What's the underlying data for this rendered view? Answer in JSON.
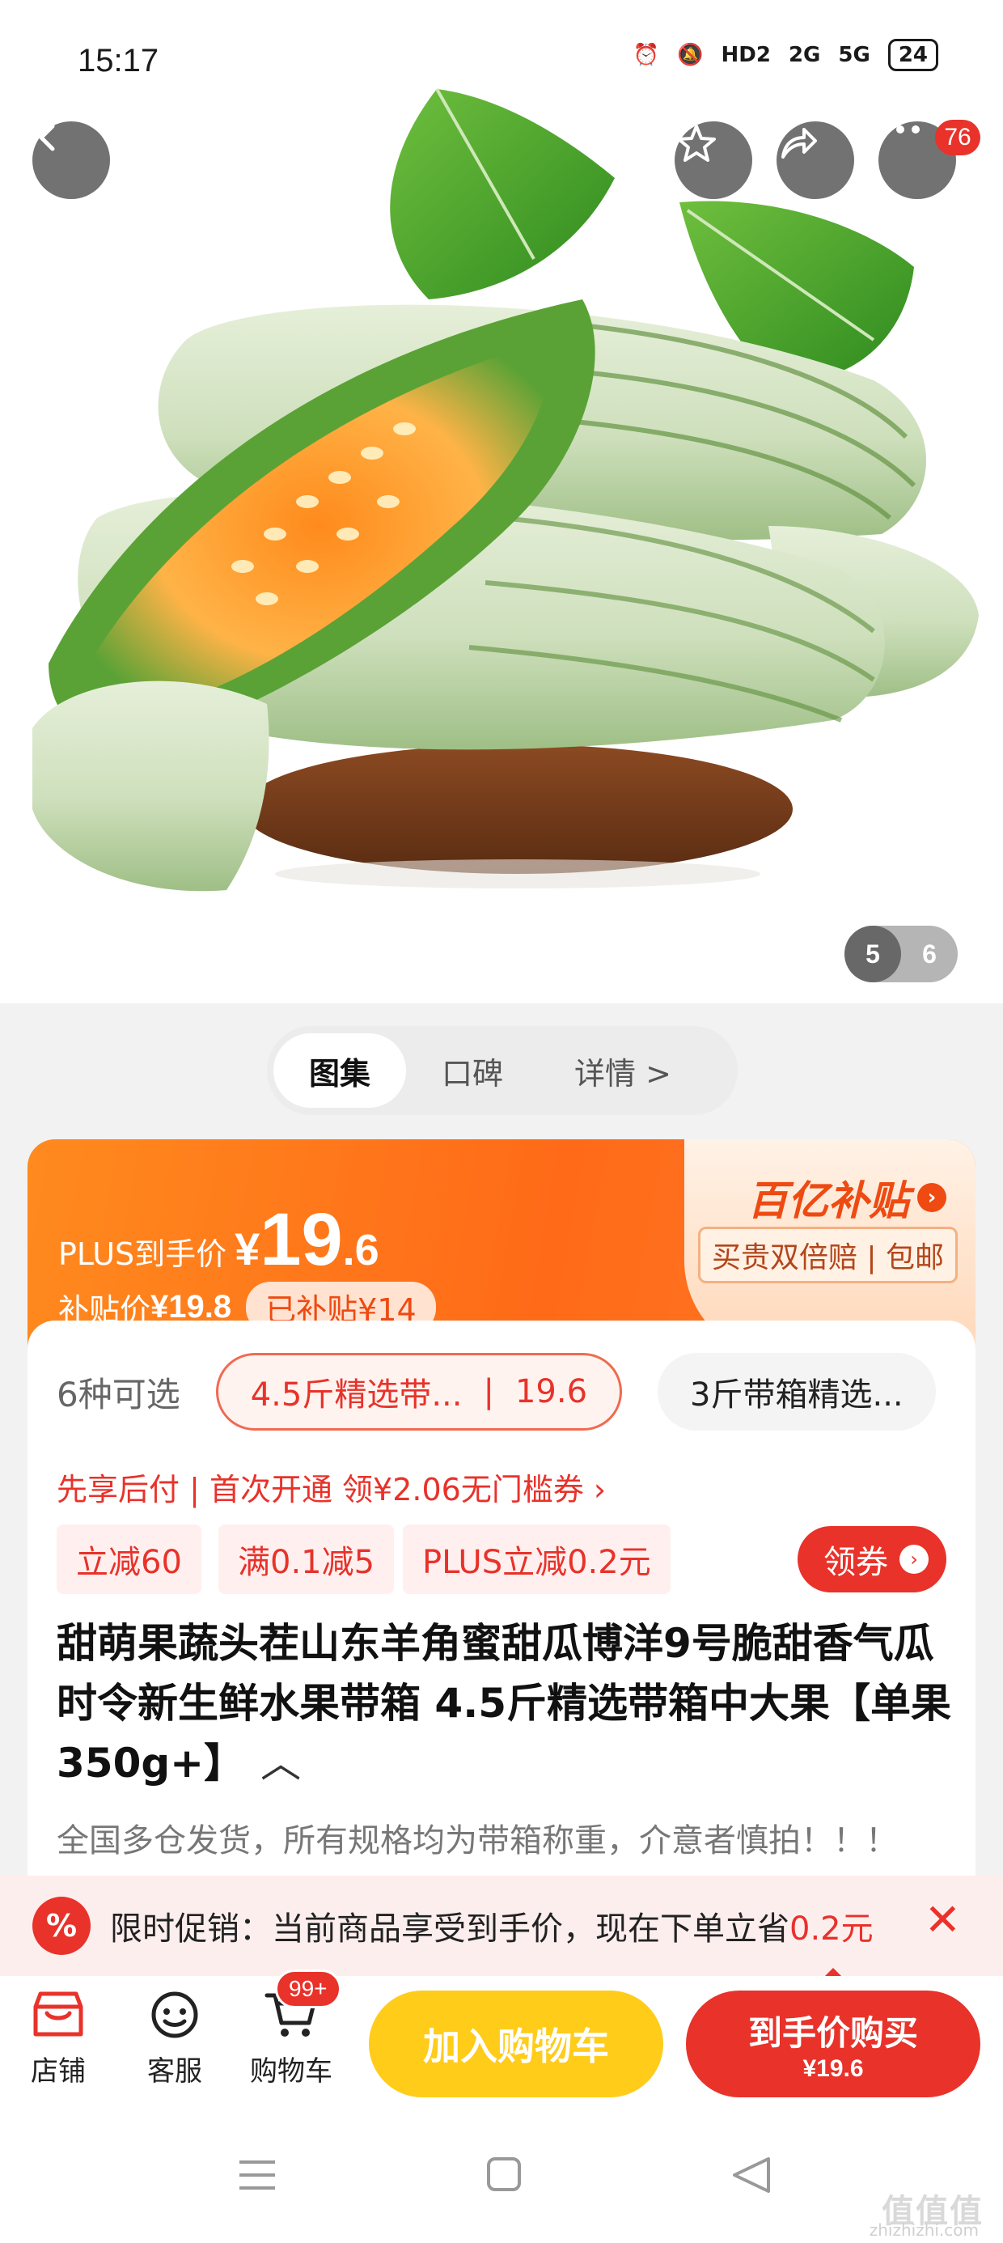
{
  "status_bar": {
    "time": "15:17",
    "network1": "2G",
    "network2": "5G",
    "battery": "24",
    "hd": "HD2"
  },
  "header": {
    "back": "back",
    "favorite": "favorite",
    "share": "share",
    "more": "more",
    "more_badge": "76"
  },
  "gallery": {
    "current": "5",
    "total": "6"
  },
  "tabs": [
    {
      "label": "图集"
    },
    {
      "label": "口碑"
    },
    {
      "label": "详情 >"
    }
  ],
  "price": {
    "plus_label": "PLUS到手价",
    "currency": "¥",
    "int": "19",
    "dec": ".6",
    "subsidy_label": "补贴价",
    "subsidy_value": "¥19.8",
    "subsidy_tag": "已补贴¥14",
    "brand": "百亿补贴",
    "guarantee": "买贵双倍赔 | 包邮"
  },
  "spec": {
    "count": "6种可选",
    "selected_name": "4.5斤精选带...",
    "selected_price": "19.6",
    "other": "3斤带箱精选..."
  },
  "pay_line": "先享后付 | 首次开通 领¥2.06无门槛券 ›",
  "coupons": [
    {
      "label": "立减60"
    },
    {
      "label": "满0.1减5"
    },
    {
      "label": "PLUS立减0.2元"
    }
  ],
  "get_coupon": "领券",
  "title": "甜萌果蔬头茬山东羊角蜜甜瓜博洋9号脆甜香气瓜时令新生鲜水果带箱 4.5斤精选带箱中大果【单果350g+】",
  "title_caret": "︿",
  "note": "全国多仓发货，所有规格均为带箱称重，介意者慎拍！！！",
  "promo": {
    "icon": "%",
    "text": "限时促销：当前商品享受到手价，现在下单立省",
    "amount": "0.2元",
    "close": "✕"
  },
  "bottom_nav": [
    {
      "label": "店铺"
    },
    {
      "label": "客服"
    },
    {
      "label": "购物车"
    }
  ],
  "cart_badge": "99+",
  "add_to_cart": "加入购物车",
  "buy_now": {
    "label": "到手价购买",
    "price": "¥19.6"
  },
  "watermark": "值值值",
  "watermark_url": "zhizhizhi.com",
  "colors": {
    "accent": "#e8322a",
    "orange": "#ff6a18",
    "yellow": "#ffcc1a"
  }
}
